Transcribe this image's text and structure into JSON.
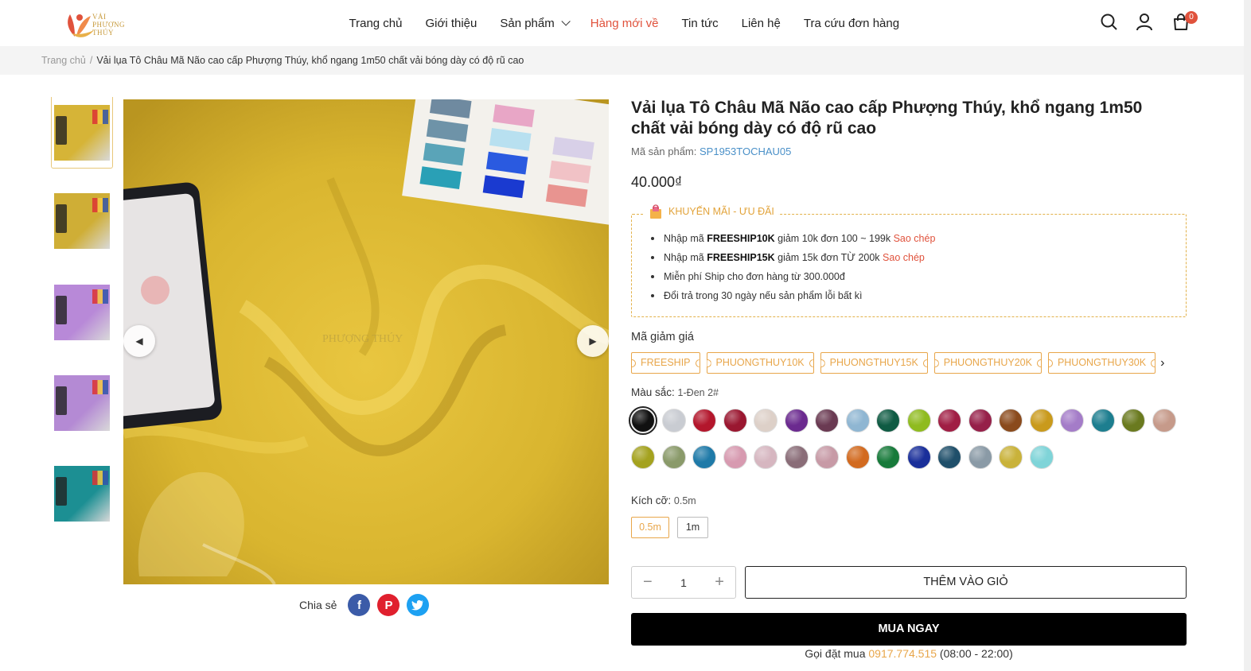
{
  "logo": {
    "line1": "VẢI",
    "line2": "PHƯỢNG",
    "line3": "THÚY"
  },
  "nav": [
    {
      "label": "Trang chủ"
    },
    {
      "label": "Giới thiệu"
    },
    {
      "label": "Sản phẩm"
    },
    {
      "label": "Hàng mới về"
    },
    {
      "label": "Tin tức"
    },
    {
      "label": "Liên hệ"
    },
    {
      "label": "Tra cứu đơn hàng"
    }
  ],
  "cart": {
    "count": "0"
  },
  "breadcrumb": {
    "home": "Trang chủ",
    "sep": "/",
    "current": "Vải lụa Tô Châu Mã Não cao cấp Phượng Thúy, khổ ngang 1m50 chất vải bóng dày có độ rũ cao"
  },
  "gallery": {
    "thumb_colors": [
      "#d6b437",
      "#cfae36",
      "#b889d8",
      "#b48ad4",
      "#1c8f93"
    ],
    "main_color": "#dcb932",
    "watermark": "PHƯỢNG THÚY"
  },
  "share": {
    "label": "Chia sẻ"
  },
  "product": {
    "title": "Vải lụa Tô Châu Mã Não cao cấp Phượng Thúy, khổ ngang 1m50 chất vải bóng dày có độ rũ cao",
    "sku_label": "Mã sản phẩm:",
    "sku": "SP1953TOCHAU05",
    "price": "40.000₫"
  },
  "promo": {
    "title": "KHUYẾN MÃI - ƯU ĐÃI",
    "items": [
      {
        "pre": "Nhập mã ",
        "code": "FREESHIP10K",
        "post": " giảm 10k đơn 100 ~ 199k ",
        "copy": "Sao chép"
      },
      {
        "pre": "Nhập mã ",
        "code": "FREESHIP15K",
        "post": " giảm 15k đơn TỪ 200k ",
        "copy": "Sao chép"
      },
      {
        "text": "Miễn phí Ship cho đơn hàng từ 300.000đ"
      },
      {
        "text": "Đổi trả trong 30 ngày nếu sản phẩm lỗi bất kì"
      }
    ]
  },
  "discount": {
    "label": "Mã giảm giá",
    "codes": [
      "FREESHIP",
      "PHUONGTHUY10K",
      "PHUONGTHUY15K",
      "PHUONGTHUY20K",
      "PHUONGTHUY30K"
    ]
  },
  "color": {
    "label": "Màu sắc:",
    "selected": "1-Đen 2#",
    "row1": [
      "#111111",
      "#c9ccd2",
      "#b3162c",
      "#9a1730",
      "#ddd0c8",
      "#6b2a8f",
      "#6a3a52",
      "#8fb6d2",
      "#0f5b43",
      "#8fbb1f",
      "#a01e44",
      "#962049",
      "#8a4a1c",
      "#c99a1c",
      "#a47cc8",
      "#1d7e8f",
      "#6a7a1f",
      "#c69a8a"
    ],
    "row2": [
      "#a4a21f",
      "#8a9a6a",
      "#1f7aa8",
      "#d79ab0",
      "#d6b6c0",
      "#8a6d78",
      "#c79aa6",
      "#d26a1f",
      "#177a3a",
      "#1a2f9a",
      "#1f4f6a",
      "#8a9aa6",
      "#c9b23a",
      "#7fd4d8"
    ]
  },
  "size": {
    "label": "Kích cỡ:",
    "selected": "0.5m",
    "options": [
      "0.5m",
      "1m"
    ]
  },
  "qty": {
    "minus": "−",
    "value": "1",
    "plus": "+"
  },
  "actions": {
    "add": "THÊM VÀO GIỎ",
    "buy": "MUA NGAY"
  },
  "call": {
    "pre": "Gọi đặt mua ",
    "phone": "0917.774.515",
    "hours": " (08:00 - 22:00)"
  }
}
